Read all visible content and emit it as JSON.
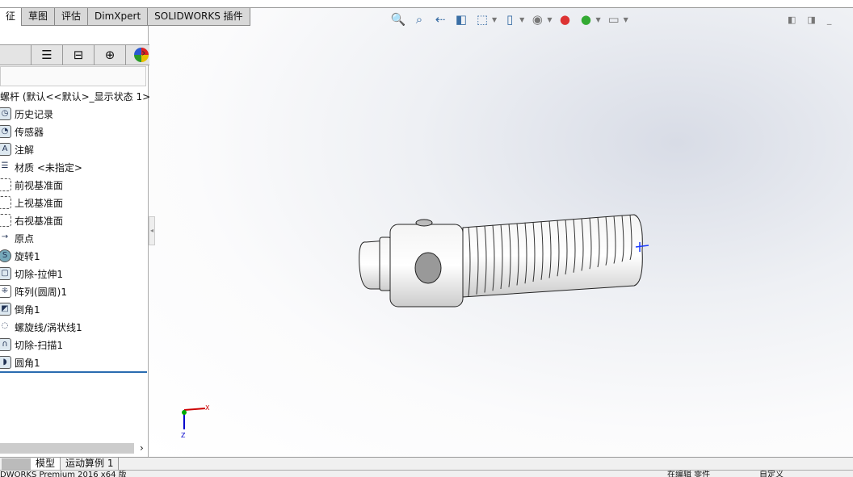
{
  "command_tabs": [
    "征",
    "草图",
    "评估",
    "DimXpert",
    "SOLIDWORKS 插件"
  ],
  "panel_tabs": [
    "feature-manager",
    "property-manager",
    "configuration-manager",
    "dimxpert-manager",
    "display-manager"
  ],
  "tree": {
    "root": "螺杆  (默认<<默认>_显示状态 1>)",
    "items": [
      {
        "label": "历史记录",
        "icon": "history-icon"
      },
      {
        "label": "传感器",
        "icon": "sensor-icon"
      },
      {
        "label": "注解",
        "icon": "annotation-icon"
      },
      {
        "label": "材质 <未指定>",
        "icon": "material-icon"
      },
      {
        "label": "前视基准面",
        "icon": "plane-icon"
      },
      {
        "label": "上视基准面",
        "icon": "plane-icon"
      },
      {
        "label": "右视基准面",
        "icon": "plane-icon"
      },
      {
        "label": "原点",
        "icon": "origin-icon"
      },
      {
        "label": "旋转1",
        "icon": "revolve-icon"
      },
      {
        "label": "切除-拉伸1",
        "icon": "cut-extrude-icon"
      },
      {
        "label": "阵列(圆周)1",
        "icon": "circular-pattern-icon"
      },
      {
        "label": "倒角1",
        "icon": "chamfer-icon"
      },
      {
        "label": "螺旋线/涡状线1",
        "icon": "helix-icon"
      },
      {
        "label": "切除-扫描1",
        "icon": "cut-sweep-icon"
      },
      {
        "label": "圆角1",
        "icon": "fillet-icon"
      }
    ]
  },
  "bottom_tabs": [
    "模型",
    "运动算例 1"
  ],
  "status": {
    "app": "DWORKS Premium 2016 x64 版",
    "mode": "在编辑 零件",
    "units": "自定义"
  },
  "triad": {
    "x": "X",
    "z": "Z"
  }
}
